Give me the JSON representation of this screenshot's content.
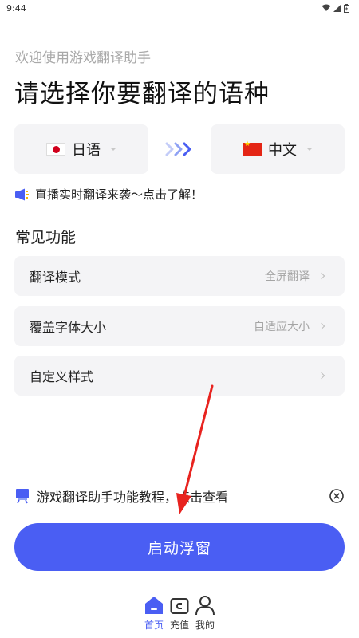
{
  "status_bar": {
    "time": "9:44"
  },
  "header": {
    "welcome": "欢迎使用游戏翻译助手",
    "title": "请选择你要翻译的语种"
  },
  "languages": {
    "source": {
      "label": "日语",
      "flag": "japan-flag"
    },
    "target": {
      "label": "中文",
      "flag": "china-flag"
    },
    "arrow_color": "#5b7af0"
  },
  "banner": {
    "text": "直播实时翻译来袭～点击了解！"
  },
  "features": {
    "title": "常见功能",
    "items": [
      {
        "label": "翻译模式",
        "value": "全屏翻译"
      },
      {
        "label": "覆盖字体大小",
        "value": "自适应大小"
      },
      {
        "label": "自定义样式",
        "value": ""
      }
    ]
  },
  "tutorial": {
    "text": "游戏翻译助手功能教程，点击查看"
  },
  "start_button": {
    "label": "启动浮窗",
    "color": "#4a5ef3"
  },
  "bottom_nav": {
    "items": [
      {
        "label": "首页",
        "icon": "home-icon",
        "active": true
      },
      {
        "label": "充值",
        "icon": "wallet-icon",
        "active": false
      },
      {
        "label": "我的",
        "icon": "user-icon",
        "active": false
      }
    ]
  },
  "accent_color": "#4a5ef3",
  "annotation_arrow_color": "#e8231f"
}
